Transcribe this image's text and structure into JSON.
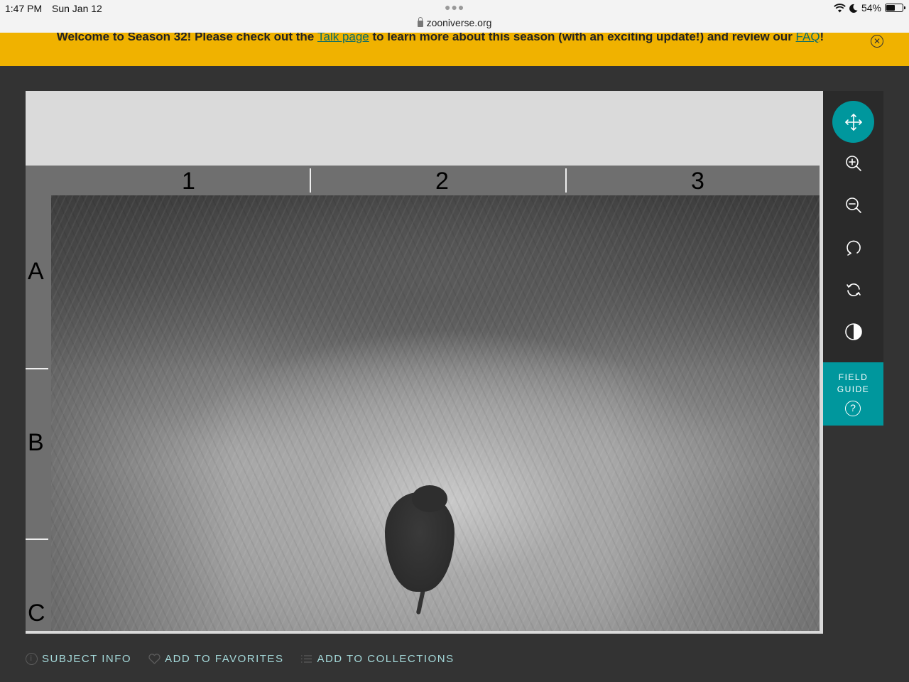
{
  "status_bar": {
    "time": "1:47 PM",
    "date": "Sun Jan 12",
    "url": "zooniverse.org",
    "battery": "54%",
    "battery_level": 0.54
  },
  "banner": {
    "text_before": "Welcome to Season 32! Please check out the ",
    "talk_link": "Talk page",
    "text_middle": " to learn more about this season (with an exciting update!) and review our ",
    "faq_link": "FAQ",
    "text_after": "!",
    "close_icon": "close-circle-icon"
  },
  "grid": {
    "columns": [
      "1",
      "2",
      "3"
    ],
    "rows": [
      "A",
      "B",
      "C"
    ]
  },
  "toolbar": {
    "tools": [
      {
        "name": "move",
        "icon": "move-arrows-icon",
        "active": true
      },
      {
        "name": "zoom-in",
        "icon": "zoom-in-icon"
      },
      {
        "name": "zoom-out",
        "icon": "zoom-out-icon"
      },
      {
        "name": "rotate",
        "icon": "rotate-icon"
      },
      {
        "name": "reset",
        "icon": "reset-icon"
      },
      {
        "name": "invert",
        "icon": "contrast-icon"
      }
    ],
    "field_guide_label": "FIELD\nGUIDE",
    "field_guide_icon": "question-circle-icon"
  },
  "meta": {
    "subject_info": "SUBJECT INFO",
    "add_to_favorites": "ADD TO FAVORITES",
    "add_to_collections": "ADD TO COLLECTIONS"
  },
  "colors": {
    "banner": "#f0b200",
    "accent": "#00979d",
    "meta_text": "#a5dadb",
    "background": "#333333"
  }
}
